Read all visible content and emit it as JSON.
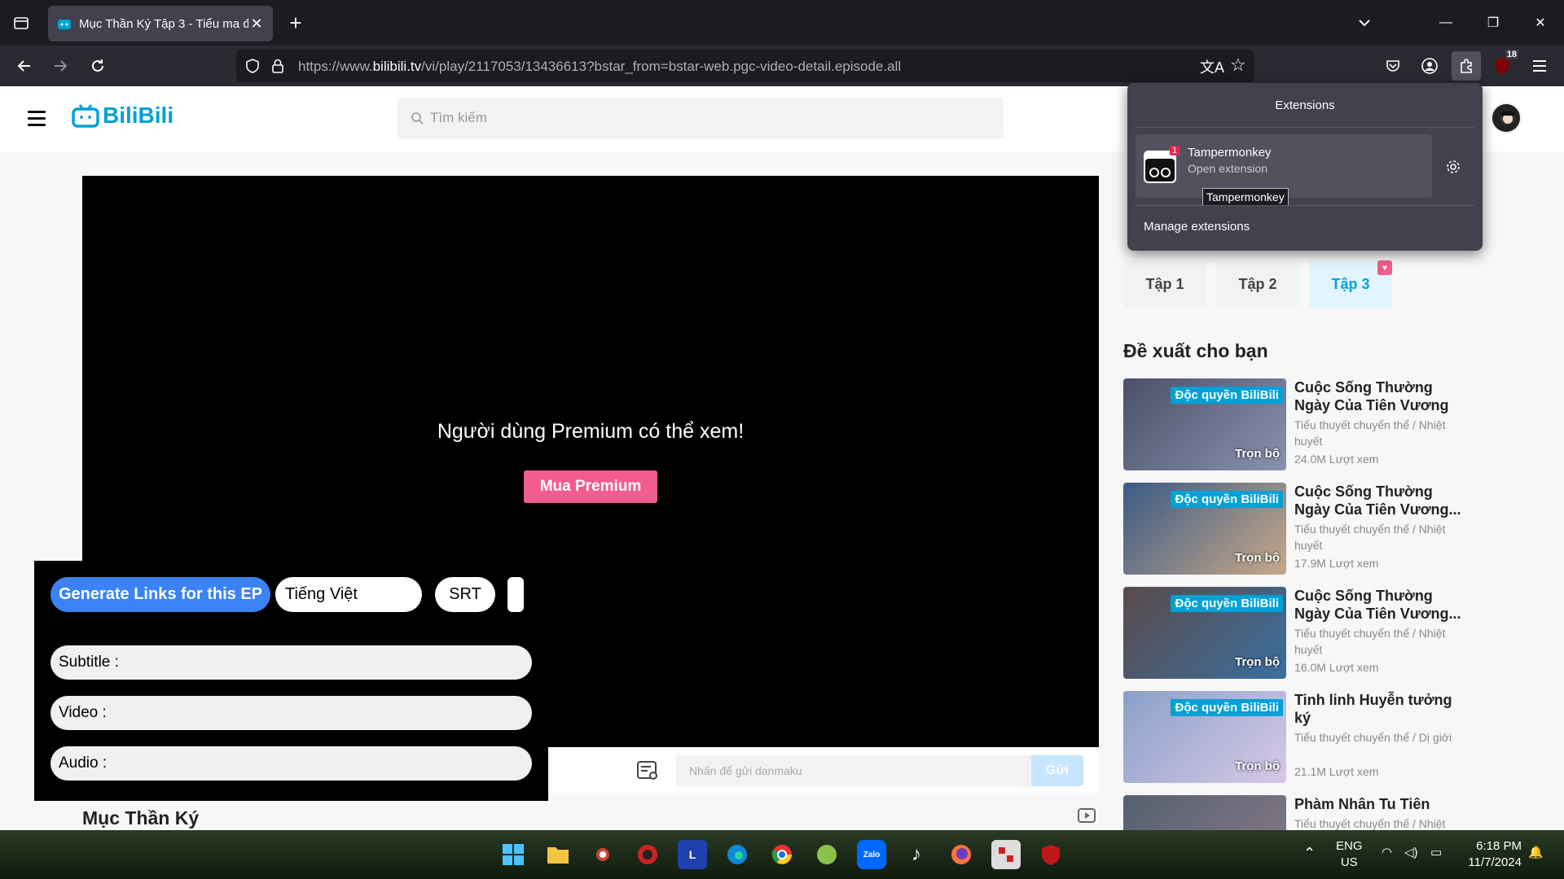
{
  "browser": {
    "tab_title": "Mục Thần Ký Tập 3 - Tiểu ma đ",
    "url_prefix": "https://www.",
    "url_domain": "bilibili.tv",
    "url_rest": "/vi/play/2117053/13436613?bstar_from=bstar-web.pgc-video-detail.episode.all",
    "notification_badge": "18"
  },
  "site": {
    "logo_text": "BiliBili",
    "search_placeholder": "Tìm kiếm"
  },
  "player": {
    "premium_message": "Người dùng Premium có thể xem!",
    "buy_premium_label": "Mua Premium",
    "danmaku_placeholder": "Nhấn để gửi danmaku",
    "send_label": "Gửi"
  },
  "series_title": "Mục Thần Ký",
  "episodes": [
    {
      "label": "Tập 1"
    },
    {
      "label": "Tập 2"
    },
    {
      "label": "Tập 3"
    }
  ],
  "recommend": {
    "heading": "Đề xuất cho bạn",
    "items": [
      {
        "badge": "Độc quyền BiliBili",
        "tag": "Trọn bộ",
        "title": "Cuộc Sống Thường Ngày Của Tiên Vương",
        "genre": "Tiểu thuyết chuyển thể / Nhiệt huyết",
        "views": "24.0M Lượt xem",
        "color": "#4a5068"
      },
      {
        "badge": "Độc quyền BiliBili",
        "tag": "Trọn bộ",
        "title": "Cuộc Sống Thường Ngày Của Tiên Vương...",
        "genre": "Tiểu thuyết chuyển thể / Nhiệt huyết",
        "views": "17.9M Lượt xem",
        "color": "#3b5a86"
      },
      {
        "badge": "Độc quyền BiliBili",
        "tag": "Trọn bộ",
        "title": "Cuộc Sống Thường Ngày Của Tiên Vương...",
        "genre": "Tiểu thuyết chuyển thể / Nhiệt huyết",
        "views": "16.0M Lượt xem",
        "color": "#5a4a4a"
      },
      {
        "badge": "Độc quyền BiliBili",
        "tag": "Trọn bộ",
        "title": "Tinh linh Huyễn tưởng ký",
        "genre": "Tiểu thuyết chuyển thể / Dị giới",
        "views": "21.1M Lượt xem",
        "color": "#8aa0c8"
      },
      {
        "badge": "",
        "tag": "",
        "title": "Phàm Nhân Tu Tiên",
        "genre": "Tiểu thuyết chuyển thể / Nhiệt",
        "views": "",
        "color": "#556070"
      }
    ]
  },
  "userscript": {
    "generate_label": "Generate Links for this EP",
    "language_value": "Tiếng Việt",
    "format_value": "SRT",
    "subtitle_label": "Subtitle :",
    "video_label": "Video :",
    "audio_label": "Audio :"
  },
  "extensions_popup": {
    "heading": "Extensions",
    "item_name": "Tampermonkey",
    "item_sub": "Open extension",
    "item_badge": "1",
    "tooltip": "Tampermonkey",
    "manage_label": "Manage extensions"
  },
  "taskbar": {
    "lang_line1": "ENG",
    "lang_line2": "US",
    "time": "6:18 PM",
    "date": "11/7/2024"
  }
}
